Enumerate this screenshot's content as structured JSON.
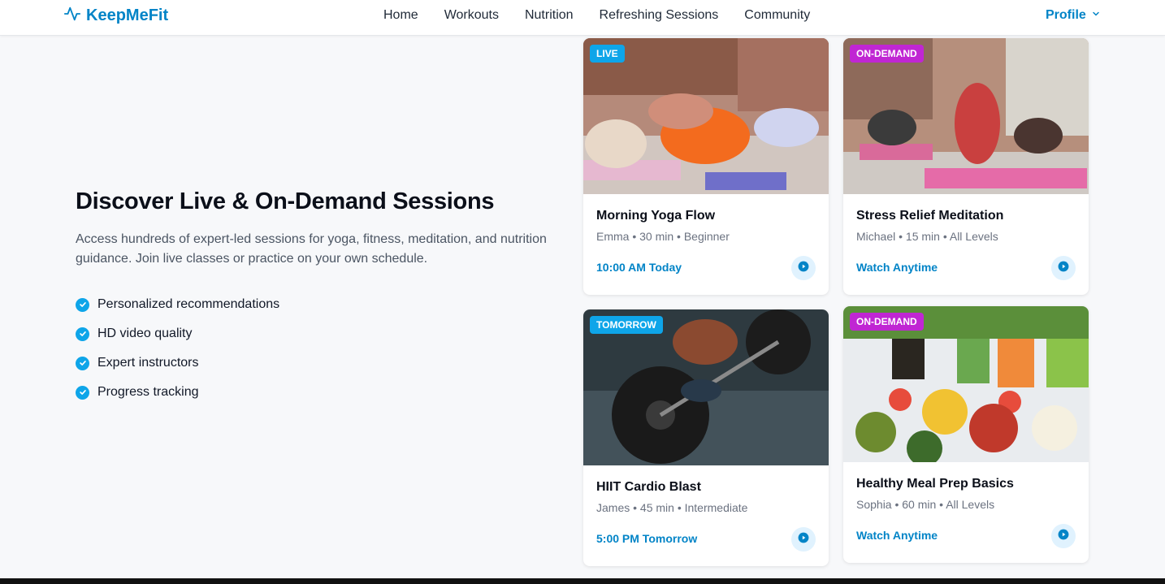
{
  "nav": {
    "brand": "KeepMeFit",
    "links": [
      "Home",
      "Workouts",
      "Nutrition",
      "Refreshing Sessions",
      "Community"
    ],
    "profile": "Profile"
  },
  "hero": {
    "title": "Discover Live & On-Demand Sessions",
    "description": "Access hundreds of expert-led sessions for yoga, fitness, meditation, and nutrition guidance. Join live classes or practice on your own schedule.",
    "features": [
      "Personalized recommendations",
      "HD video quality",
      "Expert instructors",
      "Progress tracking"
    ]
  },
  "cards": [
    {
      "badge": "LIVE",
      "badge_color": "#0ea5e9",
      "title": "Morning Yoga Flow",
      "meta": "Emma • 30 min • Beginner",
      "time": "10:00 AM Today",
      "image": "yoga-class-photo"
    },
    {
      "badge": "ON-DEMAND",
      "badge_color": "#c026d3",
      "title": "Stress Relief Meditation",
      "meta": "Michael • 15 min • All Levels",
      "time": "Watch Anytime",
      "image": "fitness-class-photo"
    },
    {
      "badge": "TOMORROW",
      "badge_color": "#0ea5e9",
      "title": "HIIT Cardio Blast",
      "meta": "James • 45 min • Intermediate",
      "time": "5:00 PM Tomorrow",
      "image": "barbell-lift-photo"
    },
    {
      "badge": "ON-DEMAND",
      "badge_color": "#c026d3",
      "title": "Healthy Meal Prep Basics",
      "meta": "Sophia • 60 min • All Levels",
      "time": "Watch Anytime",
      "image": "vegetables-photo"
    }
  ],
  "colors": {
    "accent": "#0284c7",
    "live": "#0ea5e9",
    "on_demand": "#c026d3"
  }
}
